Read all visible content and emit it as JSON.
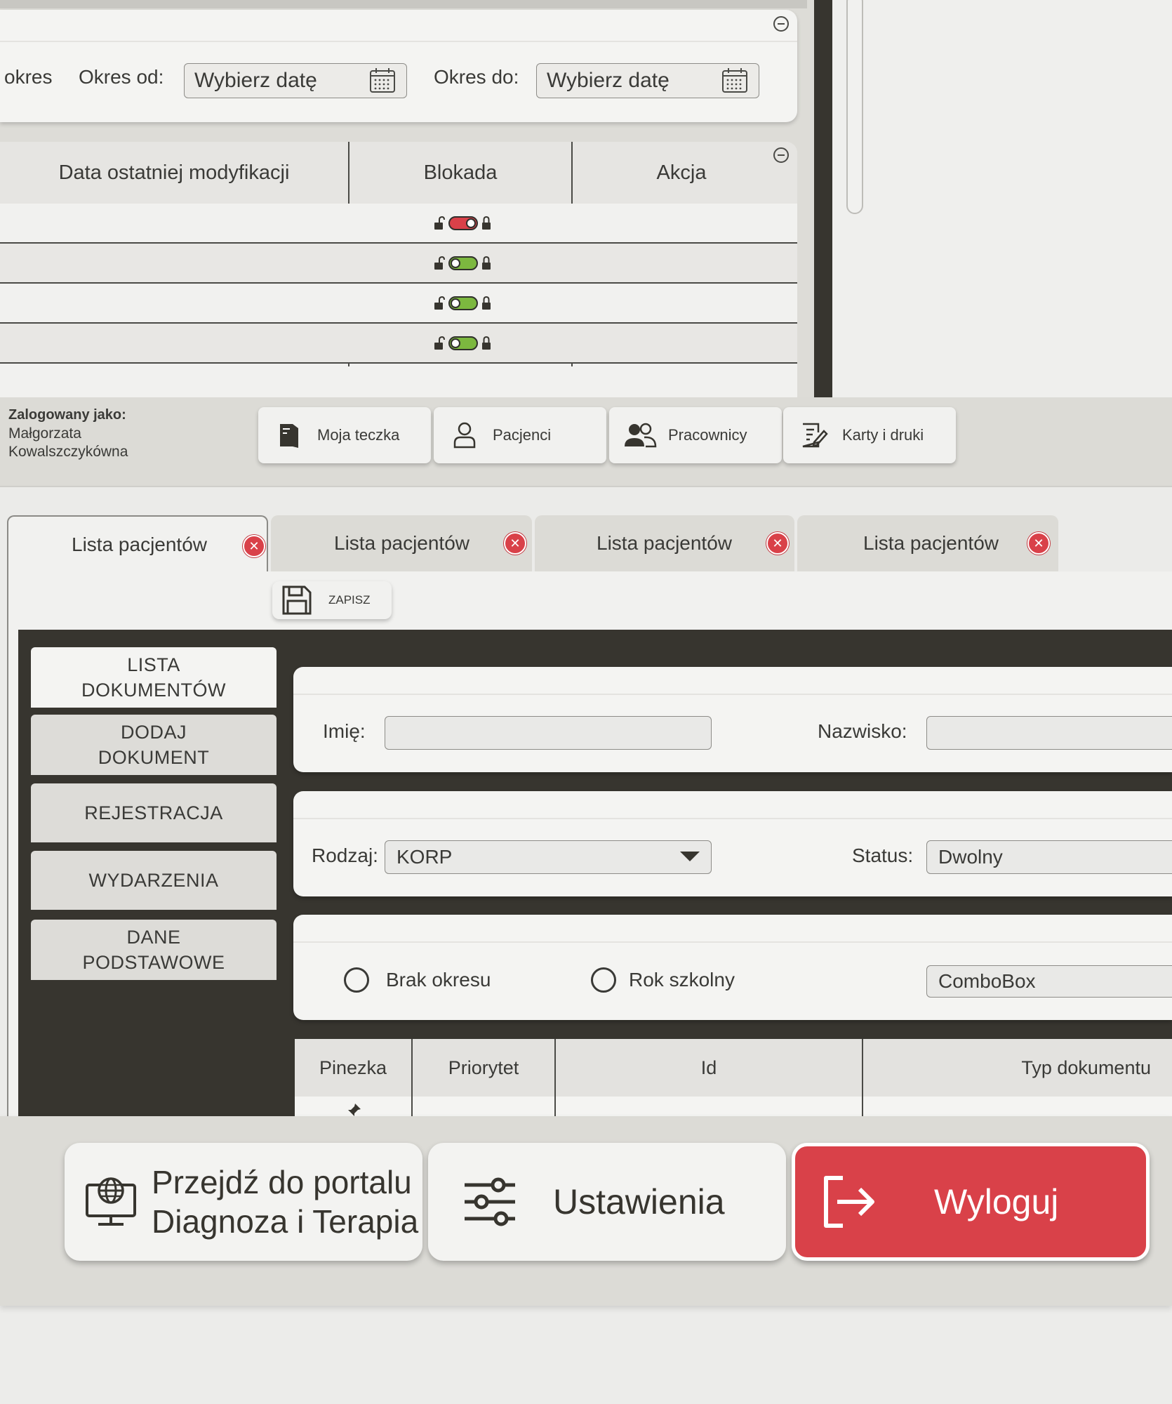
{
  "filters": {
    "okres_partial": "okres",
    "okres_od_label": "Okres od:",
    "okres_do_label": "Okres do:",
    "date_placeholder": "Wybierz datę"
  },
  "top_table": {
    "headers": [
      "Data ostatniej modyfikacji",
      "Blokada",
      "Akcja"
    ],
    "rows": [
      {
        "blokada": "locked",
        "color": "#d94149"
      },
      {
        "blokada": "unlocked",
        "color": "#7cb83f"
      },
      {
        "blokada": "unlocked",
        "color": "#7cb83f"
      },
      {
        "blokada": "unlocked",
        "color": "#7cb83f"
      }
    ]
  },
  "nav": {
    "logged_label": "Zalogowany jako:",
    "user_first": "Małgorzata",
    "user_last": "Kowalszczykówna",
    "items": [
      {
        "label": "Moja teczka",
        "icon": "folder-icon"
      },
      {
        "label": "Pacjenci",
        "icon": "user-icon"
      },
      {
        "label": "Pracownicy",
        "icon": "users-icon"
      },
      {
        "label": "Karty i druki",
        "icon": "edit-document-icon"
      }
    ]
  },
  "tabs": [
    {
      "label": "Lista pacjentów",
      "active": true
    },
    {
      "label": "Lista pacjentów",
      "active": false
    },
    {
      "label": "Lista pacjentów",
      "active": false
    },
    {
      "label": "Lista pacjentów",
      "active": false
    }
  ],
  "save_label": "ZAPISZ",
  "sidebar": {
    "items": [
      {
        "line1": "LISTA",
        "line2": "DOKUMENTÓW",
        "active": true
      },
      {
        "line1": "DODAJ",
        "line2": "DOKUMENT",
        "active": false
      },
      {
        "line1": "REJESTRACJA",
        "line2": "",
        "active": false
      },
      {
        "line1": "WYDARZENIA",
        "line2": "",
        "active": false
      },
      {
        "line1": "DANE",
        "line2": "PODSTAWOWE",
        "active": false
      }
    ]
  },
  "form": {
    "imie_label": "Imię:",
    "nazwisko_label": "Nazwisko:",
    "rodzaj_label": "Rodzaj:",
    "rodzaj_value": "KORP",
    "status_label": "Status:",
    "status_value": "Dwolny",
    "radio_brak": "Brak okresu",
    "radio_rok": "Rok szkolny",
    "combobox_value": "ComboBox"
  },
  "grid": {
    "headers": [
      "Pinezka",
      "Priorytet",
      "Id",
      "Typ dokumentu"
    ]
  },
  "bottom": {
    "portal_line1": "Przejdź do portalu",
    "portal_line2": "Diagnoza i Terapia",
    "settings_label": "Ustawienia",
    "logout_label": "Wyloguj"
  },
  "colors": {
    "accent_red": "#d94149",
    "toggle_green": "#7cb83f",
    "dark": "#37352f"
  }
}
